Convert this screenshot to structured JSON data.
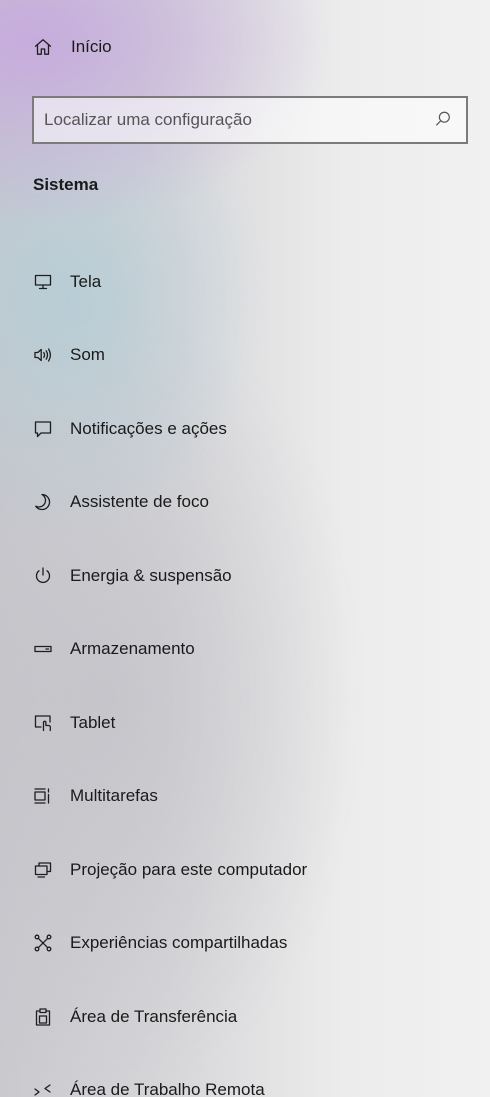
{
  "home": {
    "label": "Início",
    "icon": "home-icon"
  },
  "search": {
    "placeholder": "Localizar uma configuração",
    "value": "",
    "icon": "search-icon"
  },
  "section": {
    "title": "Sistema"
  },
  "nav": {
    "items": [
      {
        "label": "Tela",
        "icon": "monitor-icon"
      },
      {
        "label": "Som",
        "icon": "speaker-icon"
      },
      {
        "label": "Notificações e ações",
        "icon": "notification-icon"
      },
      {
        "label": "Assistente de foco",
        "icon": "moon-icon"
      },
      {
        "label": "Energia & suspensão",
        "icon": "power-icon"
      },
      {
        "label": "Armazenamento",
        "icon": "storage-drive-icon"
      },
      {
        "label": "Tablet",
        "icon": "tablet-touch-icon"
      },
      {
        "label": "Multitarefas",
        "icon": "multitasking-icon"
      },
      {
        "label": "Projeção para este computador",
        "icon": "projection-icon"
      },
      {
        "label": "Experiências compartilhadas",
        "icon": "shared-experiences-icon"
      },
      {
        "label": "Área de Transferência",
        "icon": "clipboard-icon"
      },
      {
        "label": "Área de Trabalho Remota",
        "icon": "remote-desktop-icon"
      }
    ]
  }
}
